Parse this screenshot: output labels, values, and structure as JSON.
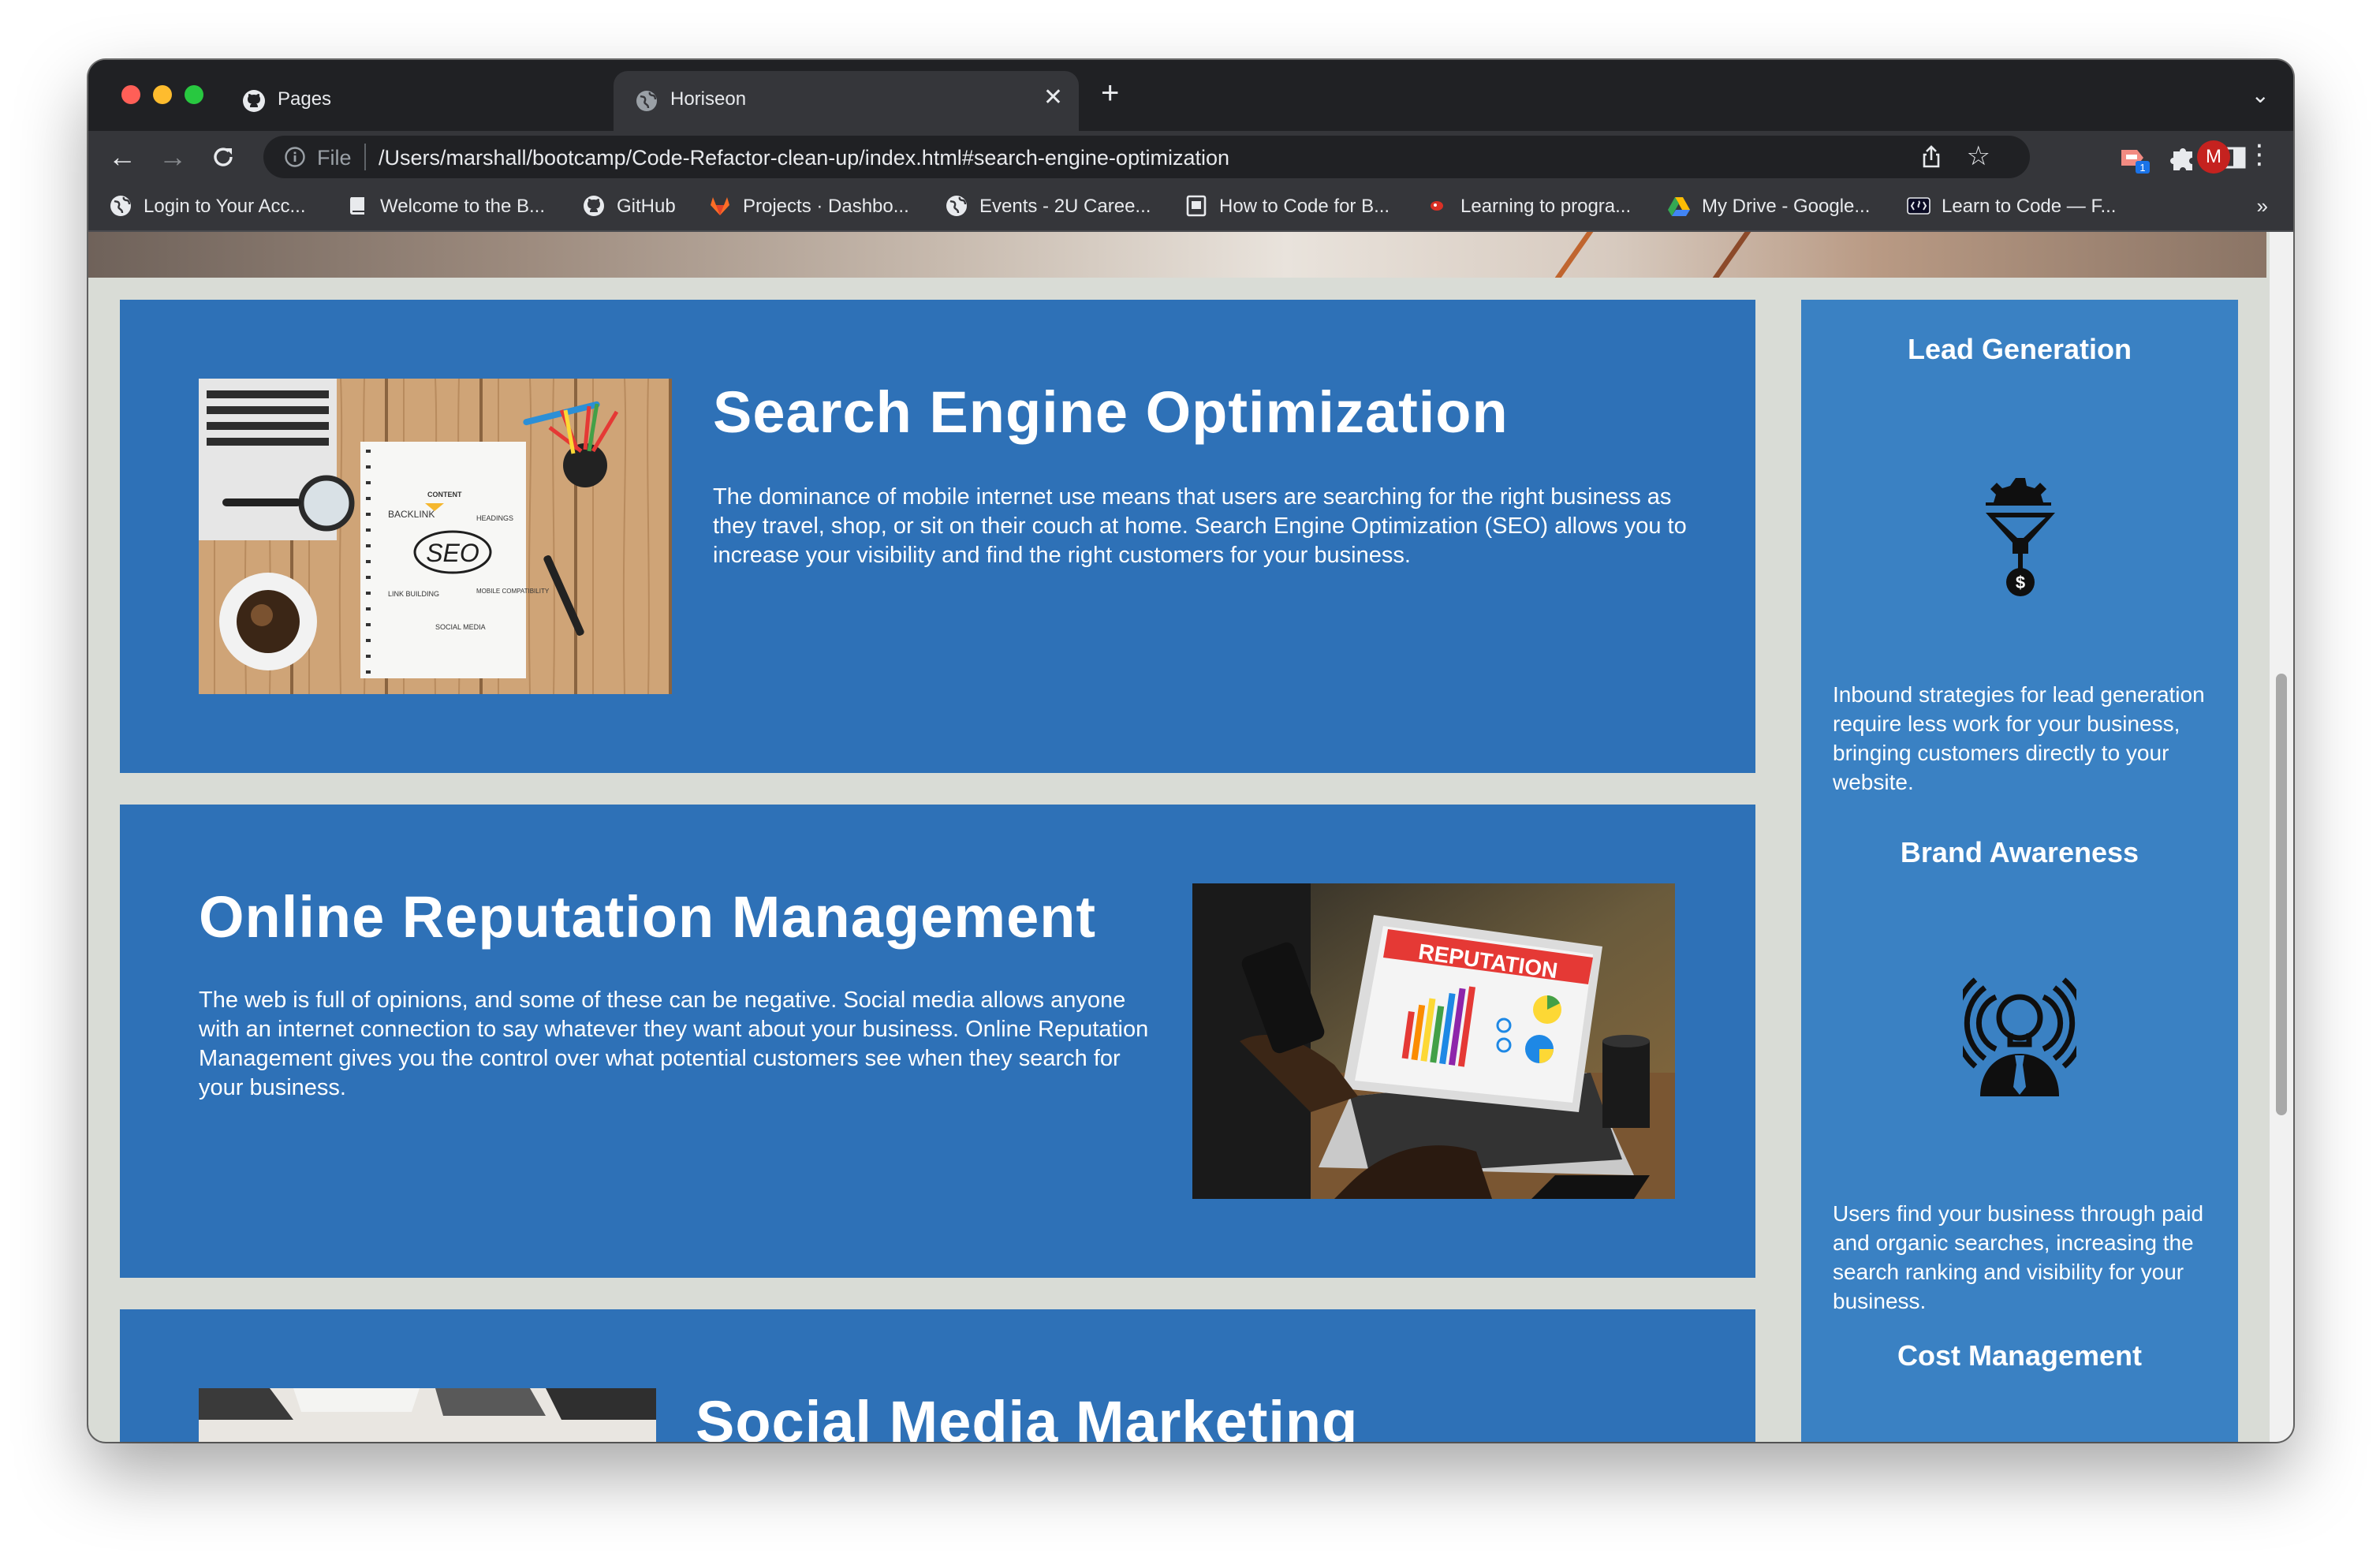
{
  "browser": {
    "tabs": [
      {
        "title": "Pages",
        "favicon": "github-icon"
      },
      {
        "title": "Horiseon",
        "favicon": "globe-icon",
        "active": true
      }
    ],
    "address": {
      "scheme_label": "File",
      "url": "/Users/marshall/bootcamp/Code-Refactor-clean-up/index.html#search-engine-optimization"
    },
    "profile_initial": "M",
    "extension_badge": "1",
    "bookmarks": [
      {
        "label": "Login to Your Acc...",
        "icon": "globe-icon"
      },
      {
        "label": "Welcome to the B...",
        "icon": "book-icon"
      },
      {
        "label": "GitHub",
        "icon": "github-icon"
      },
      {
        "label": "Projects · Dashbo...",
        "icon": "gitlab-icon"
      },
      {
        "label": "Events - 2U Caree...",
        "icon": "globe-icon"
      },
      {
        "label": "How to Code for B...",
        "icon": "page-icon"
      },
      {
        "label": "Learning to progra...",
        "icon": "red-logo-icon"
      },
      {
        "label": "My Drive - Google...",
        "icon": "google-drive-icon"
      },
      {
        "label": "Learn to Code — F...",
        "icon": "freecodecamp-icon"
      }
    ]
  },
  "content": {
    "seo": {
      "title": "Search Engine Optimization",
      "text": "The dominance of mobile internet use means that users are searching for the right business as they travel, shop, or sit on their couch at home. Search Engine Optimization (SEO) allows you to increase your visibility and find the right customers for your business.",
      "image_words": {
        "content": "CONTENT",
        "backlink": "BACKLINK",
        "headings": "HEADINGS",
        "seo": "SEO",
        "link_building": "LINK BUILDING",
        "mobile": "MOBILE COMPATIBILITY",
        "social": "SOCIAL MEDIA"
      }
    },
    "reputation": {
      "title": "Online Reputation Management",
      "text": "The web is full of opinions, and some of these can be negative. Social media allows anyone with an internet connection to say whatever they want about your business. Online Reputation Management gives you the control over what potential customers see when they search for your business.",
      "image_word": "REPUTATION"
    },
    "social": {
      "title": "Social Media Marketing"
    }
  },
  "sidebar": {
    "lead": {
      "title": "Lead Generation",
      "text": "Inbound strategies for lead generation require less work for your business, bringing customers directly to your website.",
      "icon": "lead-funnel-icon"
    },
    "brand": {
      "title": "Brand Awareness",
      "text": "Users find your business through paid and organic searches, increasing the search ranking and visibility for your business.",
      "icon": "lightbulb-person-icon"
    },
    "cost": {
      "title": "Cost Management"
    }
  }
}
